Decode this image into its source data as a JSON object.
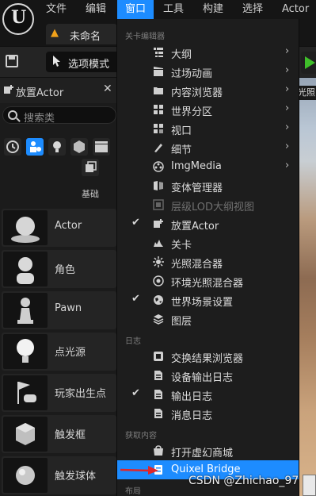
{
  "menubar": {
    "items": [
      "文件",
      "编辑",
      "窗口",
      "工具",
      "构建",
      "选择",
      "Actor"
    ],
    "active_index": 2
  },
  "level_tab": {
    "label": "未命名"
  },
  "toolbar": {
    "mode_label": "选项模式"
  },
  "panel": {
    "title": "放置Actor",
    "search_placeholder": "搜索类",
    "category_label": "基础",
    "items": [
      "Actor",
      "角色",
      "Pawn",
      "点光源",
      "玩家出生点",
      "触发框",
      "触发球体"
    ]
  },
  "viewport": {
    "tag": "光照"
  },
  "window_menu": {
    "sections": {
      "level_editor": "关卡编辑器",
      "log": "日志",
      "get_content": "获取内容",
      "layout": "布局"
    },
    "items": [
      {
        "label": "大纲",
        "icon": "outliner-icon",
        "submenu": true
      },
      {
        "label": "过场动画",
        "icon": "cinematics-icon",
        "submenu": true
      },
      {
        "label": "内容浏览器",
        "icon": "content-browser-icon",
        "submenu": true
      },
      {
        "label": "世界分区",
        "icon": "world-partition-icon",
        "submenu": true
      },
      {
        "label": "视口",
        "icon": "viewport-icon",
        "submenu": true
      },
      {
        "label": "细节",
        "icon": "details-icon",
        "submenu": true
      },
      {
        "label": "ImgMedia",
        "icon": "imgmedia-icon",
        "submenu": true
      },
      {
        "label": "变体管理器",
        "icon": "variant-manager-icon"
      },
      {
        "label": "层级LOD大纲视图",
        "icon": "hlod-icon",
        "disabled": true
      },
      {
        "label": "放置Actor",
        "icon": "place-actors-icon",
        "checked": true
      },
      {
        "label": "关卡",
        "icon": "levels-icon"
      },
      {
        "label": "光照混合器",
        "icon": "light-mixer-icon"
      },
      {
        "label": "环境光照混合器",
        "icon": "env-light-mixer-icon"
      },
      {
        "label": "世界场景设置",
        "icon": "world-settings-icon",
        "checked": true
      },
      {
        "label": "图层",
        "icon": "layers-icon"
      },
      {
        "label": "交换结果浏览器",
        "icon": "interchange-icon"
      },
      {
        "label": "设备输出日志",
        "icon": "device-log-icon"
      },
      {
        "label": "输出日志",
        "icon": "output-log-icon",
        "checked": true
      },
      {
        "label": "消息日志",
        "icon": "message-log-icon"
      },
      {
        "label": "打开虚幻商城",
        "icon": "marketplace-icon"
      },
      {
        "label": "Quixel Bridge",
        "icon": "quixel-bridge-icon",
        "highlighted": true
      }
    ],
    "check_glyph": "✔",
    "submenu_glyph": "›"
  },
  "watermark": "CSDN @Zhichao_97",
  "colors": {
    "accent": "#1d8cff",
    "play": "#3fbf2a",
    "warning": "#f0a11a",
    "arrow": "#e0262a"
  }
}
